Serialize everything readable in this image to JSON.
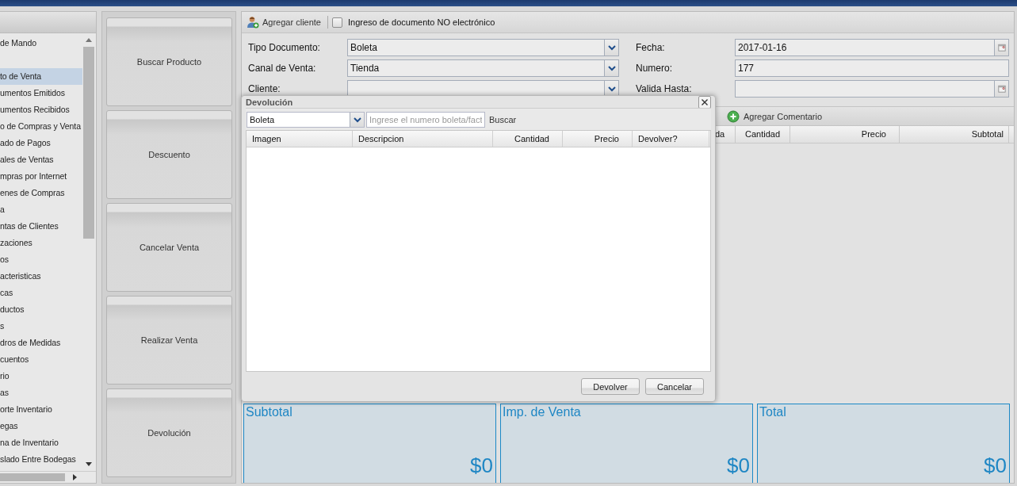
{
  "sidebar": {
    "items": [
      {
        "label": "de Mando",
        "selected": false
      },
      {
        "label": "to de Venta",
        "selected": true
      },
      {
        "label": "umentos Emitidos",
        "selected": false
      },
      {
        "label": "umentos Recibidos",
        "selected": false
      },
      {
        "label": "o de Compras y Venta",
        "selected": false
      },
      {
        "label": "ado de Pagos",
        "selected": false
      },
      {
        "label": "ales de Ventas",
        "selected": false
      },
      {
        "label": "mpras por Internet",
        "selected": false
      },
      {
        "label": "enes de Compras",
        "selected": false
      },
      {
        "label": "a",
        "selected": false
      },
      {
        "label": "ntas de Clientes",
        "selected": false
      },
      {
        "label": "zaciones",
        "selected": false
      },
      {
        "label": "os",
        "selected": false
      },
      {
        "label": "acteristicas",
        "selected": false
      },
      {
        "label": "cas",
        "selected": false
      },
      {
        "label": "ductos",
        "selected": false
      },
      {
        "label": "s",
        "selected": false
      },
      {
        "label": "dros de Medidas",
        "selected": false
      },
      {
        "label": "cuentos",
        "selected": false
      },
      {
        "label": "rio",
        "selected": false
      },
      {
        "label": "as",
        "selected": false
      },
      {
        "label": "orte Inventario",
        "selected": false
      },
      {
        "label": "egas",
        "selected": false
      },
      {
        "label": "na de Inventario",
        "selected": false
      },
      {
        "label": "slado Entre Bodegas",
        "selected": false
      }
    ]
  },
  "actions": [
    "Buscar Producto",
    "Descuento",
    "Cancelar Venta",
    "Realizar Venta",
    "Devolución"
  ],
  "toolbar": {
    "add_client": "Agregar cliente",
    "no_electronic": {
      "label": "Ingreso de documento NO electrónico",
      "checked": false
    }
  },
  "form": {
    "left": [
      {
        "label": "Tipo Documento:",
        "value": "Boleta",
        "kind": "combo"
      },
      {
        "label": "Canal de Venta:",
        "value": "Tienda",
        "kind": "combo"
      },
      {
        "label": "Cliente:",
        "kind": "combo"
      }
    ],
    "right": [
      {
        "label": "Fecha:",
        "value": "2017-01-16",
        "kind": "date"
      },
      {
        "label": "Numero:",
        "value": "177",
        "kind": "text"
      },
      {
        "label": "Valida Hasta:",
        "kind": "date"
      }
    ]
  },
  "items_toolbar": {
    "add_comment": "Agregar Comentario"
  },
  "items_table": {
    "columns": [
      "da",
      "Cantidad",
      "Precio",
      "Subtotal"
    ]
  },
  "totals": [
    {
      "label": "Subtotal",
      "value": "$0"
    },
    {
      "label": "Imp. de Venta",
      "value": "$0"
    },
    {
      "label": "Total",
      "value": "$0"
    }
  ],
  "dialog": {
    "title": "Devolución",
    "doc_type": "Boleta",
    "search": {
      "placeholder": "Ingrese el numero boleta/fact"
    },
    "search_button": "Buscar",
    "columns": [
      "Imagen",
      "Descripcion",
      "Cantidad",
      "Precio",
      "Devolver?"
    ],
    "buttons": [
      "Devolver",
      "Cancelar"
    ]
  }
}
